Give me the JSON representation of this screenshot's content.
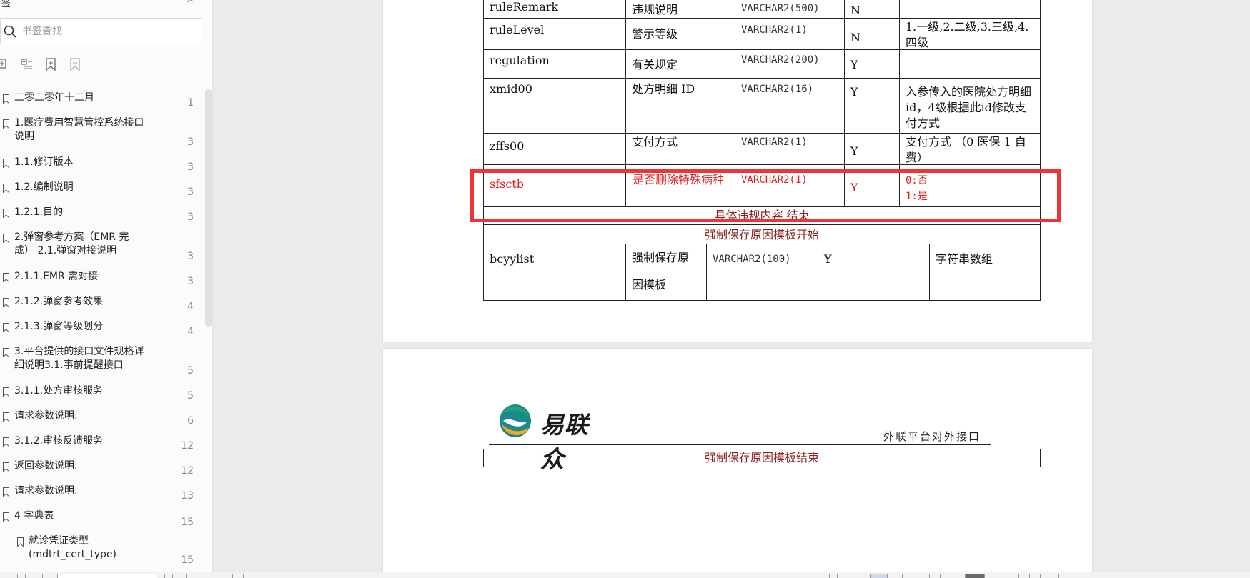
{
  "sidebar": {
    "title": "签",
    "search": {
      "placeholder": "书签查找"
    },
    "bookmarks": [
      {
        "label": "二零二零年十二月",
        "page": "1"
      },
      {
        "label": "1.医疗费用智慧管控系统接口说明",
        "page": "3"
      },
      {
        "label": "1.1.修订版本",
        "page": "3"
      },
      {
        "label": "1.2.编制说明",
        "page": "3"
      },
      {
        "label": "1.2.1.目的",
        "page": "3"
      },
      {
        "label": "2.弹窗参考方案（EMR 完成） 2.1.弹窗对接说明",
        "page": "3"
      },
      {
        "label": "2.1.1.EMR 需对接",
        "page": "3"
      },
      {
        "label": "2.1.2.弹窗参考效果",
        "page": "4"
      },
      {
        "label": "2.1.3.弹窗等级划分",
        "page": "4"
      },
      {
        "label": "3.平台提供的接口文件规格详细说明3.1.事前提醒接口",
        "page": "5"
      },
      {
        "label": "3.1.1.处方审核服务",
        "page": "5"
      },
      {
        "label": "请求参数说明:",
        "page": "6"
      },
      {
        "label": "3.1.2.审核反馈服务",
        "page": "12"
      },
      {
        "label": "返回参数说明:",
        "page": "12"
      },
      {
        "label": "请求参数说明:",
        "page": "13"
      },
      {
        "label": "4 字典表",
        "page": "15"
      },
      {
        "label": "就诊凭证类型(mdtrt_cert_type)",
        "page": "15"
      }
    ]
  },
  "document": {
    "table1": {
      "rows": [
        {
          "field": "ruleRemark",
          "name": "违规说明",
          "type": "VARCHAR2(500)",
          "nullable": "N",
          "note": ""
        },
        {
          "field": "ruleLevel",
          "name": "警示等级",
          "type": "VARCHAR2(1)",
          "nullable": "N",
          "note": "1.一级,2.二级,3.三级,4.四级"
        },
        {
          "field": "regulation",
          "name": "有关规定",
          "type": "VARCHAR2(200)",
          "nullable": "Y",
          "note": ""
        },
        {
          "field": "xmid00",
          "name": "处方明细 ID",
          "type": "VARCHAR2(16)",
          "nullable": "Y",
          "note": "入参传入的医院处方明细id，4级根据此id修改支付方式"
        },
        {
          "field": "zffs00",
          "name": "支付方式",
          "type": "VARCHAR2(1)",
          "nullable": "Y",
          "note": "支付方式 （0 医保 1 自费）"
        },
        {
          "field": "sfsctb",
          "name": "是否删除特殊病种",
          "type": "VARCHAR2(1)",
          "nullable": "Y",
          "note_line1": "0:否",
          "note_line2": "1:是"
        }
      ],
      "section_end": "具体违规内容 结束",
      "section_start2": "强制保存原因模板开始",
      "bcyy_row": {
        "field": "bcyylist",
        "name_line1": "强制保存原",
        "name_line2": "因模板",
        "type": "VARCHAR2(100)",
        "nullable": "Y",
        "note": "字符串数组"
      }
    },
    "page2": {
      "logo_text": "易联众",
      "header_text": "外联平台对外接口",
      "section_end": "强制保存原因模板结束"
    }
  },
  "colors": {
    "highlight": "#ee3535",
    "red_text": "#e02020",
    "dark_red_text": "#8b2020"
  }
}
